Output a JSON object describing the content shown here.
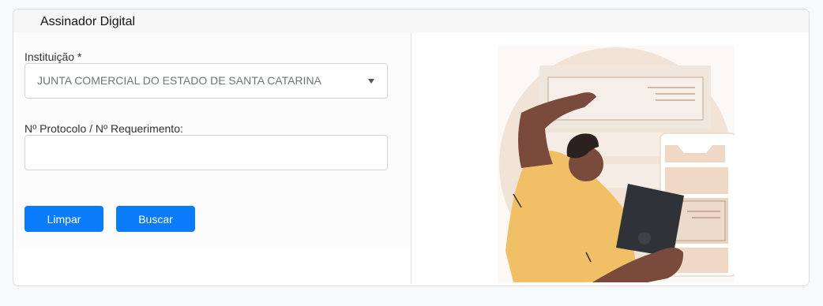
{
  "card": {
    "title": "Assinador Digital"
  },
  "form": {
    "institution": {
      "label": "Instituição  *",
      "selected": "JUNTA COMERCIAL DO ESTADO DE SANTA CATARINA"
    },
    "protocol": {
      "label": "Nº Protocolo / Nº Requerimento:",
      "value": "",
      "placeholder": ""
    },
    "buttons": {
      "clear_label": "Limpar",
      "search_label": "Buscar"
    }
  },
  "colors": {
    "primary": "#0b7cf9",
    "illustration_peach": "#f2e3d7",
    "illustration_skin": "#7a4a3c",
    "illustration_shirt": "#f0bf66",
    "illustration_device": "#2f3236"
  }
}
